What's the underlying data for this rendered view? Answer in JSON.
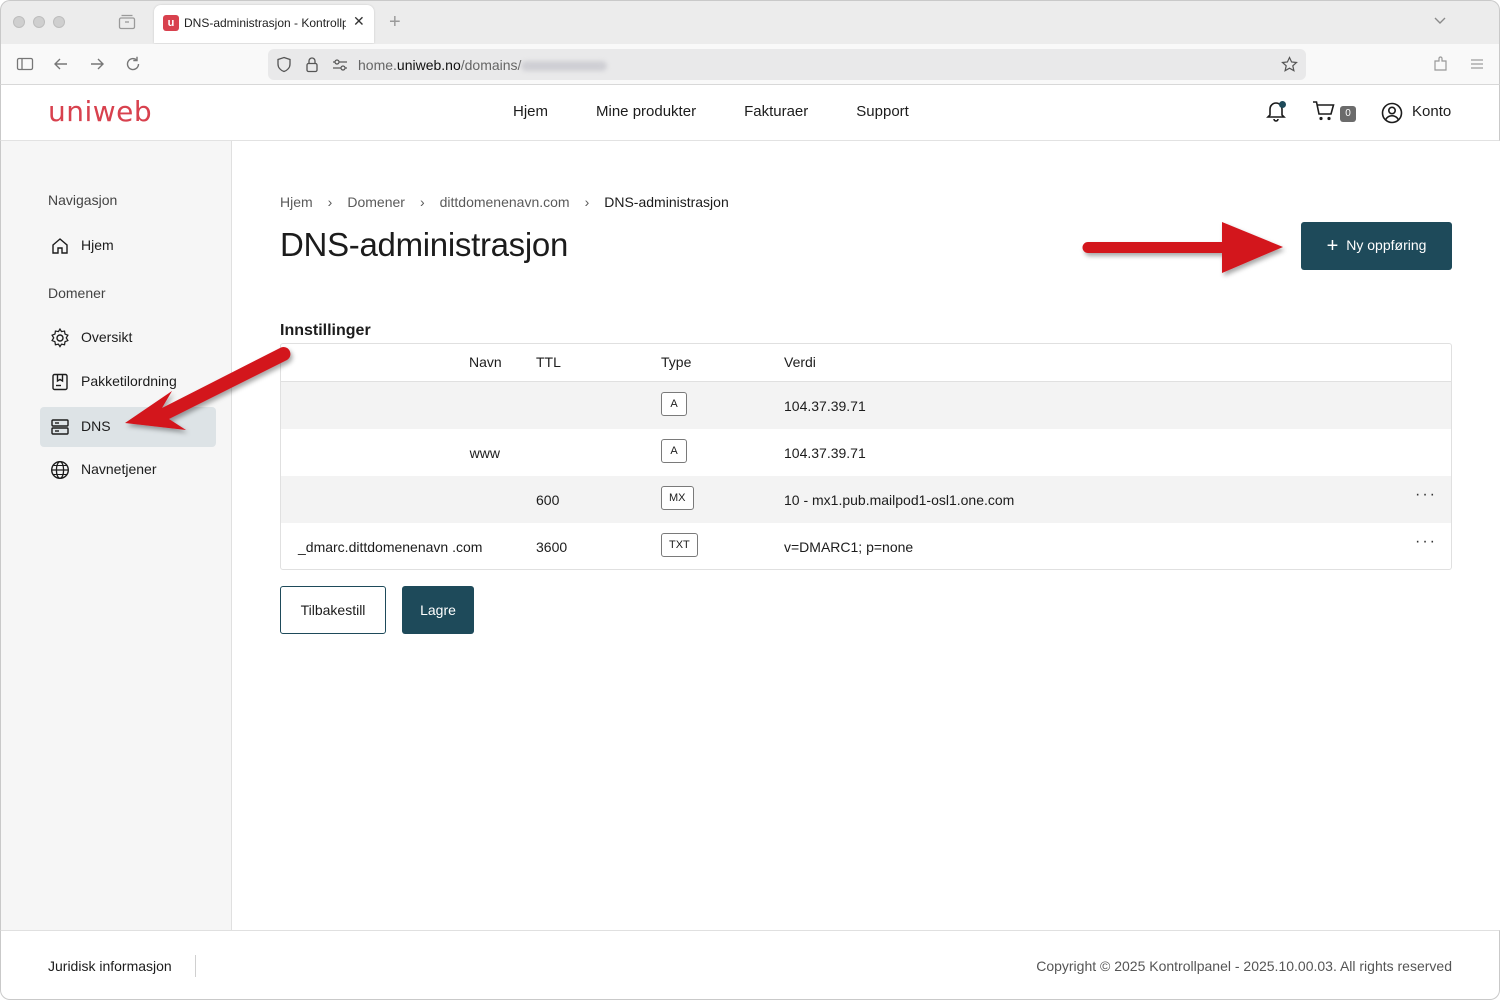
{
  "browser": {
    "tab_title": "DNS-administrasjon - Kontrollpanel",
    "url_prefix": "home.",
    "url_domain": "uniweb.no",
    "url_path": "/domains/"
  },
  "header": {
    "logo": "uniweb",
    "nav": [
      "Hjem",
      "Mine produkter",
      "Fakturaer",
      "Support"
    ],
    "cart_count": "0",
    "account_label": "Konto"
  },
  "sidebar": {
    "heading_nav": "Navigasjon",
    "home": "Hjem",
    "heading_domains": "Domener",
    "items": [
      {
        "label": "Oversikt",
        "icon": "gear-icon"
      },
      {
        "label": "Pakketilordning",
        "icon": "package-icon"
      },
      {
        "label": "DNS",
        "icon": "server-icon",
        "active": true
      },
      {
        "label": "Navnetjener",
        "icon": "globe-icon"
      }
    ]
  },
  "breadcrumb": [
    "Hjem",
    "Domener",
    "dittdomenenavn.com",
    "DNS-administrasjon"
  ],
  "page_title": "DNS-administrasjon",
  "new_record_button": "Ny oppføring",
  "section_title": "Innstillinger",
  "table": {
    "headers": {
      "name": "Navn",
      "ttl": "TTL",
      "type": "Type",
      "value": "Verdi"
    },
    "rows": [
      {
        "name": "",
        "ttl": "",
        "type": "A",
        "value": "104.37.39.71",
        "menu": ""
      },
      {
        "name": "www",
        "ttl": "",
        "type": "A",
        "value": "104.37.39.71",
        "menu": ""
      },
      {
        "name": "",
        "ttl": "600",
        "type": "MX",
        "value": "10 - mx1.pub.mailpod1-osl1.one.com",
        "menu": "···"
      },
      {
        "name": "_dmarc.dittdomenenavn .com",
        "ttl": "3600",
        "type": "TXT",
        "value": "v=DMARC1; p=none",
        "menu": "···"
      }
    ]
  },
  "buttons": {
    "reset": "Tilbakestill",
    "save": "Lagre"
  },
  "footer": {
    "legal": "Juridisk informasjon",
    "copyright": "Copyright © 2025 Kontrollpanel - 2025.10.00.03. All rights reserved"
  },
  "colors": {
    "brand": "#d8414e",
    "primary": "#1e4a5a",
    "annotation_arrow": "#d3141f"
  }
}
